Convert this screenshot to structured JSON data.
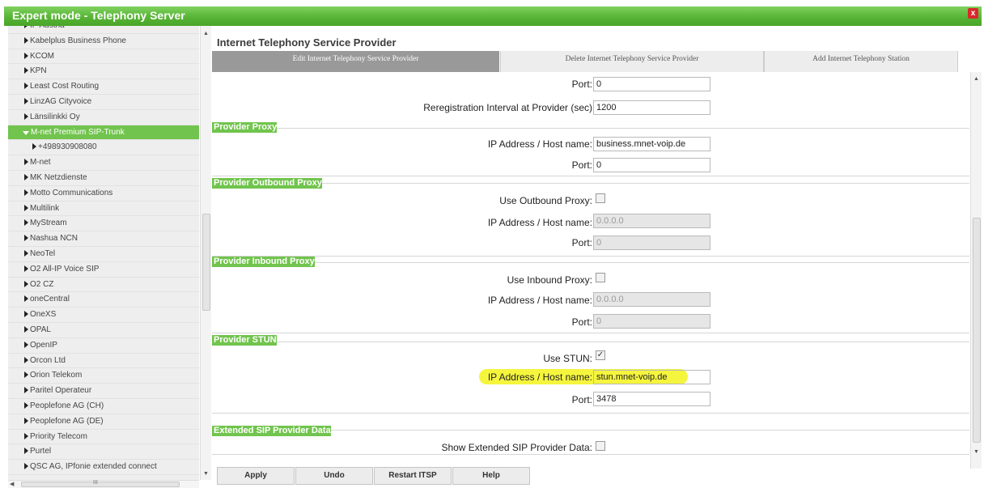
{
  "window": {
    "title": "Expert mode - Telephony Server",
    "close_label": "x"
  },
  "sidebar": {
    "items": [
      {
        "label": "IP Austria"
      },
      {
        "label": "Kabelplus Business Phone"
      },
      {
        "label": "KCOM"
      },
      {
        "label": "KPN"
      },
      {
        "label": "Least Cost Routing"
      },
      {
        "label": "LinzAG Cityvoice"
      },
      {
        "label": "Länsilinkki Oy"
      },
      {
        "label": "M-net Premium SIP-Trunk",
        "active": true
      },
      {
        "label": "+498930908080",
        "sub": true
      },
      {
        "label": "M-net"
      },
      {
        "label": "MK Netzdienste"
      },
      {
        "label": "Motto Communications"
      },
      {
        "label": "Multilink"
      },
      {
        "label": "MyStream"
      },
      {
        "label": "Nashua NCN"
      },
      {
        "label": "NeoTel"
      },
      {
        "label": "O2 All-IP Voice SIP"
      },
      {
        "label": "O2 CZ"
      },
      {
        "label": "oneCentral"
      },
      {
        "label": "OneXS"
      },
      {
        "label": "OPAL"
      },
      {
        "label": "OpenIP"
      },
      {
        "label": "Orcon Ltd"
      },
      {
        "label": "Orion Telekom"
      },
      {
        "label": "Paritel Operateur"
      },
      {
        "label": "Peoplefone AG (CH)"
      },
      {
        "label": "Peoplefone AG (DE)"
      },
      {
        "label": "Priority Telecom"
      },
      {
        "label": "Purtel"
      },
      {
        "label": "QSC AG, IPfonie extended connect"
      }
    ],
    "hscroll_grip": "III"
  },
  "main": {
    "title": "Internet Telephony Service Provider",
    "tabs": [
      {
        "label": "Edit Internet Telephony Service Provider"
      },
      {
        "label": "Delete Internet Telephony Service Provider"
      },
      {
        "label": "Add Internet Telephony Station"
      }
    ],
    "top": {
      "port_label": "Port:",
      "port_value": "0",
      "rereg_label": "Reregistration Interval at Provider (sec)",
      "rereg_value": "1200"
    },
    "provider_proxy": {
      "header": "Provider Proxy",
      "ip_label": "IP Address / Host name:",
      "ip_value": "business.mnet-voip.de",
      "port_label": "Port:",
      "port_value": "0"
    },
    "outbound_proxy": {
      "header": "Provider Outbound Proxy",
      "use_label": "Use Outbound Proxy:",
      "use_checked": "",
      "ip_label": "IP Address / Host name:",
      "ip_value": "0.0.0.0",
      "port_label": "Port:",
      "port_value": "0"
    },
    "inbound_proxy": {
      "header": "Provider Inbound Proxy",
      "use_label": "Use Inbound Proxy:",
      "use_checked": "",
      "ip_label": "IP Address / Host name:",
      "ip_value": "0.0.0.0",
      "port_label": "Port:",
      "port_value": "0"
    },
    "stun": {
      "header": "Provider STUN",
      "use_label": "Use STUN:",
      "use_checked": "✓",
      "ip_label": "IP Address / Host name:",
      "ip_value": "stun.mnet-voip.de",
      "port_label": "Port:",
      "port_value": "3478",
      "highlight_color": "#f3f31c"
    },
    "extended": {
      "header": "Extended SIP Provider Data",
      "show_label": "Show Extended SIP Provider Data:",
      "show_checked": ""
    }
  },
  "buttons": {
    "apply": "Apply",
    "undo": "Undo",
    "restart": "Restart ITSP",
    "help": "Help"
  },
  "colors": {
    "accent_green": "#71c44d",
    "title_green": "#55b233",
    "active_tab": "#999999"
  }
}
